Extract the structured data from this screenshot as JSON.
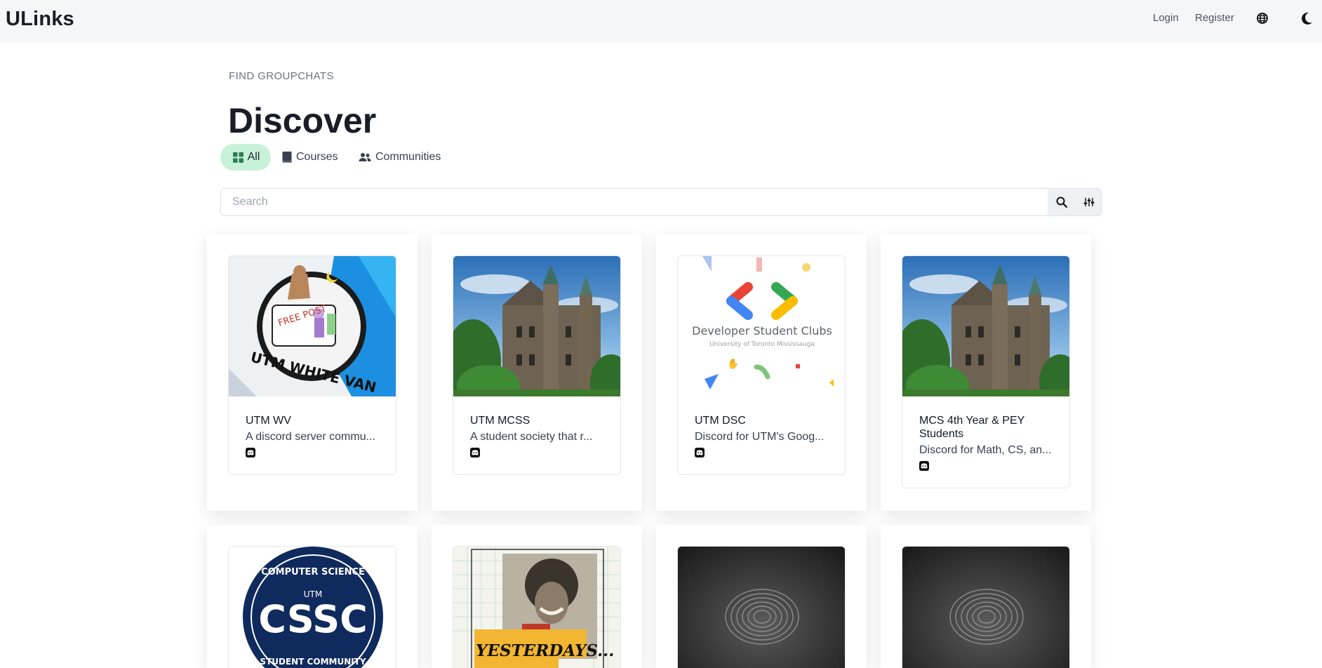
{
  "brand": "ULinks",
  "nav": {
    "login": "Login",
    "register": "Register",
    "icons": [
      "globe-icon",
      "moon-icon"
    ]
  },
  "header": {
    "eyebrow": "FIND GROUPCHATS",
    "title": "Discover"
  },
  "tabs": [
    {
      "label": "All",
      "icon": "grid-icon",
      "active": true
    },
    {
      "label": "Courses",
      "icon": "book-icon",
      "active": false
    },
    {
      "label": "Communities",
      "icon": "users-icon",
      "active": false
    }
  ],
  "search": {
    "placeholder": "Search",
    "value": "",
    "icons": [
      "search-icon",
      "sliders-icon"
    ]
  },
  "cards": [
    {
      "title": "UTM WV",
      "description": "A discord server commu...",
      "image": "utm-white-van-logo",
      "platform": "discord-icon"
    },
    {
      "title": "UTM MCSS",
      "description": "A student society that r...",
      "image": "campus-building-photo",
      "platform": "discord-icon"
    },
    {
      "title": "UTM DSC",
      "description": "Discord for UTM's Goog...",
      "image": "developer-student-clubs-logo",
      "platform": "discord-icon"
    },
    {
      "title": "MCS 4th Year & PEY Students",
      "description": "Discord for Math, CS, an...",
      "image": "campus-building-photo",
      "platform": "discord-icon"
    },
    {
      "title": "",
      "description": "",
      "image": "cssc-logo",
      "platform": ""
    },
    {
      "title": "",
      "description": "",
      "image": "yesterdays-collage",
      "platform": ""
    },
    {
      "title": "",
      "description": "",
      "image": "fingerprint-photo",
      "platform": ""
    },
    {
      "title": "",
      "description": "",
      "image": "fingerprint-photo",
      "platform": ""
    }
  ],
  "logo_text": {
    "white_van": "UTM WHITE VAN",
    "free_post": "FREE POST",
    "dsc_line1": "Developer Student Clubs",
    "dsc_line2": "University of Toronto Mississauga",
    "cssc_top": "COMPUTER SCIENCE",
    "cssc_mid": "UTM",
    "cssc_main": "CSSC",
    "cssc_bottom": "STUDENT COMMUNITY",
    "yesterdays": "YESTERDAYS..."
  },
  "colors": {
    "active_tab_bg": "#c7f2d8",
    "topbar_bg": "#f5f6f8",
    "title": "#1a1d27",
    "cssc_navy": "#0f2a5c"
  }
}
